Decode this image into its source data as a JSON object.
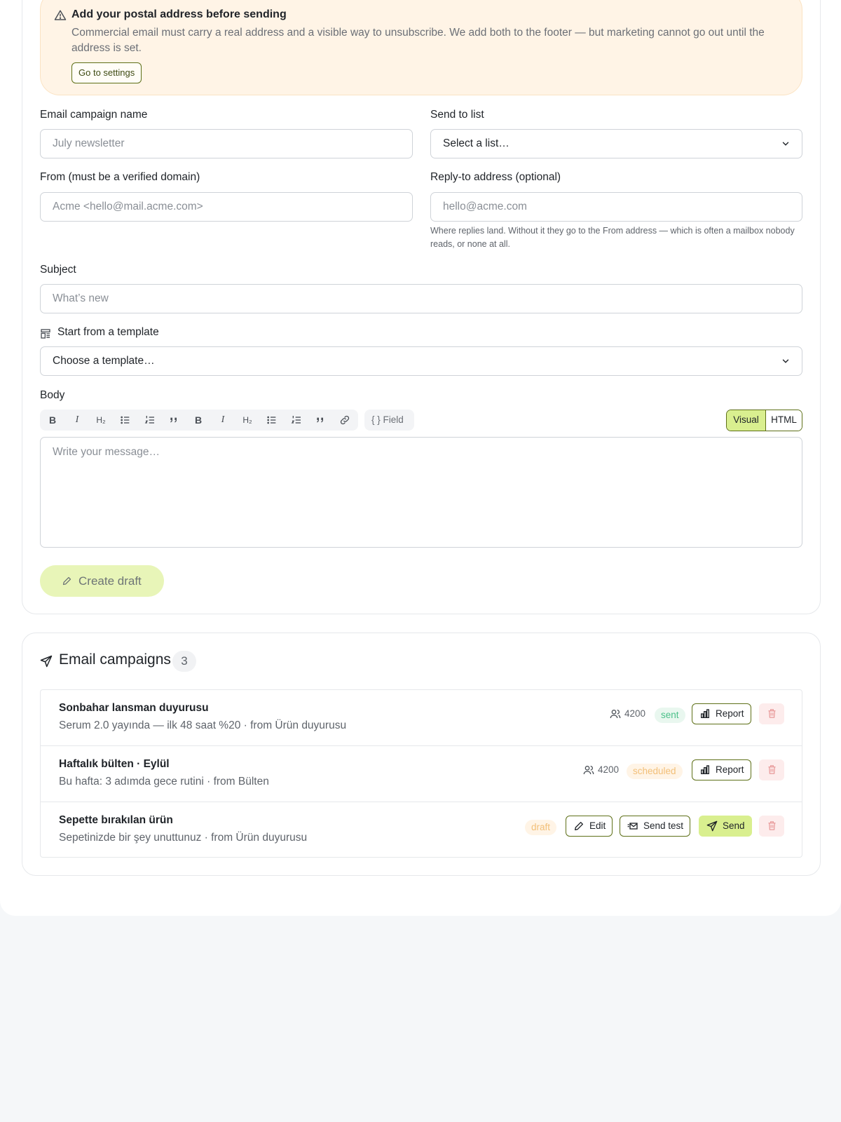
{
  "warning": {
    "title": "Add your postal address before sending",
    "body": "Commercial email must carry a real address and a visible way to unsubscribe. We add both to the footer — but marketing cannot go out until the address is set.",
    "button": "Go to settings"
  },
  "form": {
    "campaign_name_label": "Email campaign name",
    "campaign_name_placeholder": "July newsletter",
    "send_to_label": "Send to list",
    "send_to_value": "Select a list…",
    "from_label": "From (must be a verified domain)",
    "from_placeholder": "Acme <hello@mail.acme.com>",
    "reply_label": "Reply-to address (optional)",
    "reply_placeholder": "hello@acme.com",
    "reply_help": "Where replies land. Without it they go to the From address — which is often a mailbox nobody reads, or none at all.",
    "subject_label": "Subject",
    "subject_placeholder": "What’s new",
    "template_label": "Start from a template",
    "template_value": "Choose a template…",
    "body_label": "Body",
    "body_placeholder": "Write your message…",
    "toolbar": [
      "bold",
      "italic",
      "heading",
      "bullet-list",
      "numbered-list",
      "quote",
      "bold",
      "italic",
      "heading",
      "bullet-list",
      "numbered-list",
      "quote",
      "link"
    ],
    "field_button": "{ } Field",
    "mode_visual": "Visual",
    "mode_html": "HTML",
    "create_draft": "Create draft"
  },
  "campaigns": {
    "title": "Email campaigns",
    "count": "3",
    "items": [
      {
        "title": "Sonbahar lansman duyurusu",
        "subtitle": "Serum 2.0 yayında — ilk 48 saat %20 · from Ürün duyurusu",
        "recipients": "4200",
        "status": "sent",
        "actions": [
          "Report"
        ]
      },
      {
        "title": "Haftalık bülten · Eylül",
        "subtitle": "Bu hafta: 3 adımda gece rutini · from Bülten",
        "recipients": "4200",
        "status": "scheduled",
        "actions": [
          "Report"
        ]
      },
      {
        "title": "Sepette bırakılan ürün",
        "subtitle": "Sepetinizde bir şey unuttunuz · from Ürün duyurusu",
        "recipients": "",
        "status": "draft",
        "actions": [
          "Edit",
          "Send test",
          "Send"
        ]
      }
    ]
  },
  "colors": {
    "accent": "#d9ef8f",
    "accent_border": "#5e7018",
    "warning_bg": "#fff4e6",
    "sent": "#4cc08a",
    "scheduled": "#f2bf78",
    "danger_bg": "#fdecec"
  }
}
